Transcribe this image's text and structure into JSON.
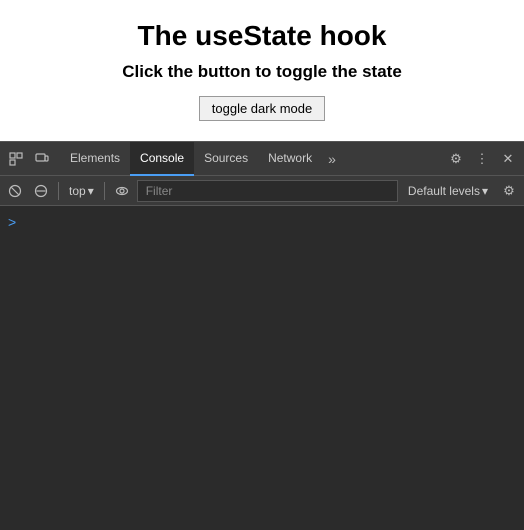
{
  "page": {
    "title": "The useState hook",
    "subtitle": "Click the button to toggle the state",
    "toggle_button_label": "toggle dark mode"
  },
  "devtools": {
    "tabs": [
      {
        "id": "elements",
        "label": "Elements",
        "active": false
      },
      {
        "id": "console",
        "label": "Console",
        "active": true
      },
      {
        "id": "sources",
        "label": "Sources",
        "active": false
      },
      {
        "id": "network",
        "label": "Network",
        "active": false
      }
    ],
    "more_tabs_icon": "»",
    "toolbar": {
      "context_select": "top",
      "filter_placeholder": "Filter",
      "default_levels_label": "Default levels"
    },
    "icons": {
      "inspect": "⬚",
      "device": "▭",
      "ban": "⊘",
      "eye": "◉",
      "chevron_down": "▾",
      "settings": "⚙",
      "more": "⋮",
      "close": "✕",
      "console_prompt": ">"
    },
    "colors": {
      "active_tab_indicator": "#4a9ef5"
    }
  }
}
